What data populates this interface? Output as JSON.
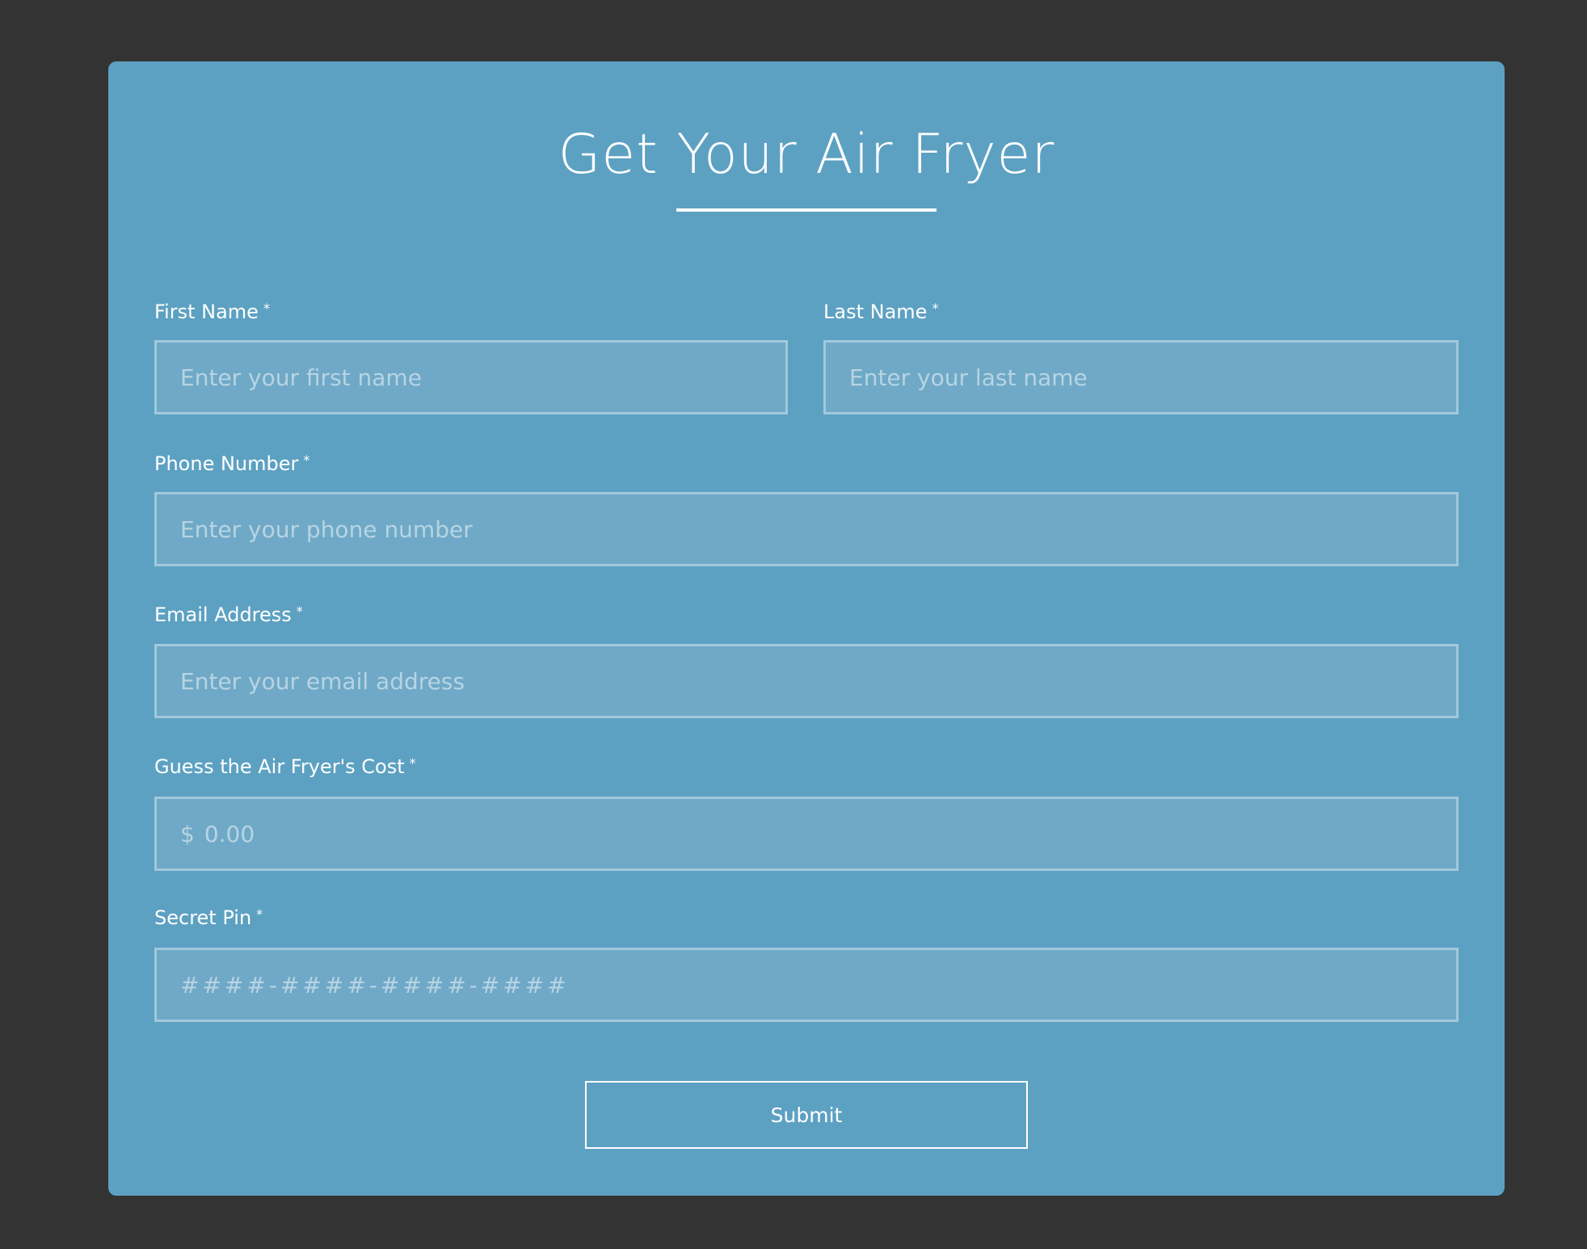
{
  "form": {
    "title": "Get Your Air Fryer",
    "required_marker": "*",
    "fields": {
      "first_name": {
        "label": "First Name",
        "placeholder": "Enter your first name"
      },
      "last_name": {
        "label": "Last Name",
        "placeholder": "Enter your last name"
      },
      "phone": {
        "label": "Phone Number",
        "placeholder": "Enter your phone number"
      },
      "email": {
        "label": "Email Address",
        "placeholder": "Enter your email address"
      },
      "cost": {
        "label": "Guess the Air Fryer's Cost",
        "currency_symbol": "$",
        "placeholder": "0.00"
      },
      "pin": {
        "label": "Secret Pin",
        "placeholder": "####-####-####-####"
      }
    },
    "submit_label": "Submit"
  },
  "colors": {
    "page_background": "#333333",
    "card_background": "#5da1c2",
    "input_background": "#6fa9c7",
    "input_border": "#a2c8dc",
    "text": "#ffffff"
  }
}
